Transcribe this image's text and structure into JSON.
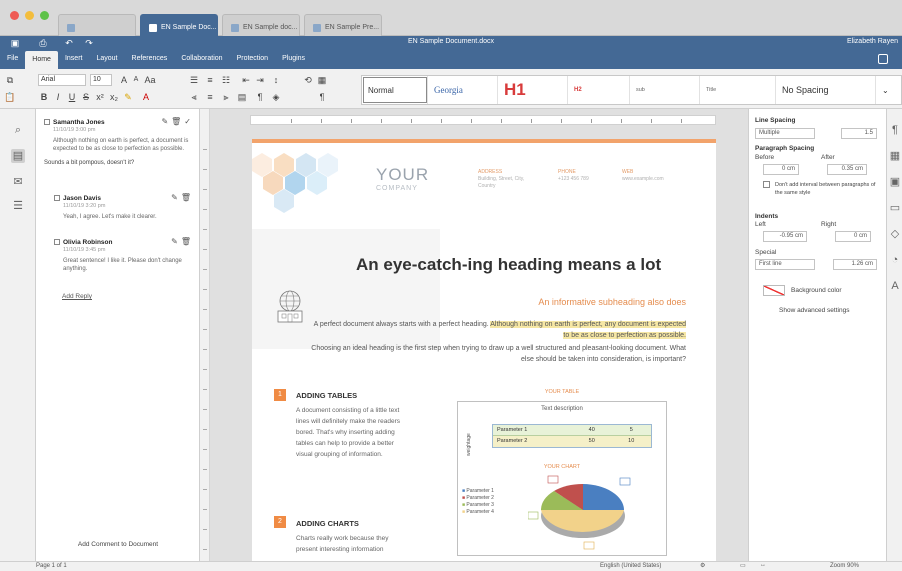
{
  "window": {
    "tabs": [
      {
        "label": ""
      },
      {
        "label": "EN Sample Doc..."
      },
      {
        "label": "EN Sample doc..."
      },
      {
        "label": "EN Sample Pre..."
      }
    ],
    "active_tab_index": 1
  },
  "header": {
    "doc_title": "EN Sample Document.docx",
    "user_name": "Elizabeth Rayen",
    "menu_tabs": [
      "File",
      "Home",
      "Insert",
      "Layout",
      "References",
      "Collaboration",
      "Protection",
      "Plugins"
    ],
    "active_menu": "Home"
  },
  "toolbar": {
    "font_name": "Arial",
    "font_size": "10",
    "styles": [
      {
        "label": "Normal"
      },
      {
        "label": "Georgia"
      },
      {
        "label": "H1"
      },
      {
        "label": "H2"
      },
      {
        "label": "sub"
      },
      {
        "label": "Title"
      },
      {
        "label": "No Spacing"
      }
    ]
  },
  "comments": {
    "items": [
      {
        "author": "Samantha Jones",
        "date": "11/10/19 3:00 pm",
        "text": "Although nothing on earth is perfect, a document is expected to be as close to perfection as possible.",
        "reply_text": "Sounds a bit pompous, doesn't it?"
      },
      {
        "author": "Jason Davis",
        "date": "11/10/19 3:20 pm",
        "text": "Yeah, I agree. Let's make it clearer."
      },
      {
        "author": "Olivia Robinson",
        "date": "11/10/19 3:45 pm",
        "text": "Great sentence! I like it. Please don't change anything."
      }
    ],
    "add_reply": "Add Reply",
    "add_comment": "Add Comment to Document"
  },
  "document": {
    "logo_line1": "YOUR",
    "logo_line2": "COMPANY",
    "header_cols": [
      {
        "label": "ADDRESS",
        "text": "Building, Street, City, Country"
      },
      {
        "label": "PHONE",
        "text": "+123 456 789"
      },
      {
        "label": "WEB",
        "text": "www.example.com"
      }
    ],
    "heading": "An eye-catch-ing heading means a lot",
    "subheading": "An informative subheading also does",
    "para_1a": "A perfect document always starts with a perfect heading. ",
    "para_1b": "Although nothing on earth is perfect, any document is expected to be as close to perfection as possible.",
    "para_2": "Choosing an ideal heading is the first step when trying to draw up a well structured and pleasant-looking document. What else should be taken into consideration, is important?",
    "sections": [
      {
        "num": "1",
        "title": "ADDING TABLES",
        "text": "A document consisting of a little text lines will definitely make the readers bored. That's why inserting adding tables can help to provide a better visual grouping of information."
      },
      {
        "num": "2",
        "title": "ADDING CHARTS",
        "text": "Charts really work because they present interesting information"
      }
    ],
    "table_caption": "YOUR TABLE",
    "table": {
      "description": "Text description",
      "side_label": "weightage",
      "rows": [
        {
          "name": "Parameter 1",
          "v1": "40",
          "v2": "5"
        },
        {
          "name": "Parameter 2",
          "v1": "50",
          "v2": "10"
        }
      ]
    },
    "chart": {
      "title": "YOUR CHART",
      "legend": [
        "Parameter 1",
        "Parameter 2",
        "Parameter 3",
        "Parameter 4"
      ],
      "colors": [
        "#4a7fc1",
        "#c0504d",
        "#9bbb59",
        "#f2d28a"
      ]
    }
  },
  "right_panel": {
    "line_spacing_label": "Line Spacing",
    "line_spacing_type": "Multiple",
    "line_spacing_value": "1.5",
    "para_spacing_label": "Paragraph Spacing",
    "before_label": "Before",
    "after_label": "After",
    "before_value": "0 cm",
    "after_value": "0.35 cm",
    "dont_add_interval": "Don't add interval between paragraphs of the same style",
    "indents_label": "Indents",
    "left_label": "Left",
    "right_label": "Right",
    "left_value": "-0.95 cm",
    "right_value": "0 cm",
    "special_label": "Special",
    "special_type": "First line",
    "special_value": "1.26 cm",
    "bg_color_label": "Background color",
    "advanced": "Show advanced settings"
  },
  "status": {
    "page": "Page 1 of 1",
    "language": "English (United States)",
    "zoom": "Zoom 90%"
  }
}
